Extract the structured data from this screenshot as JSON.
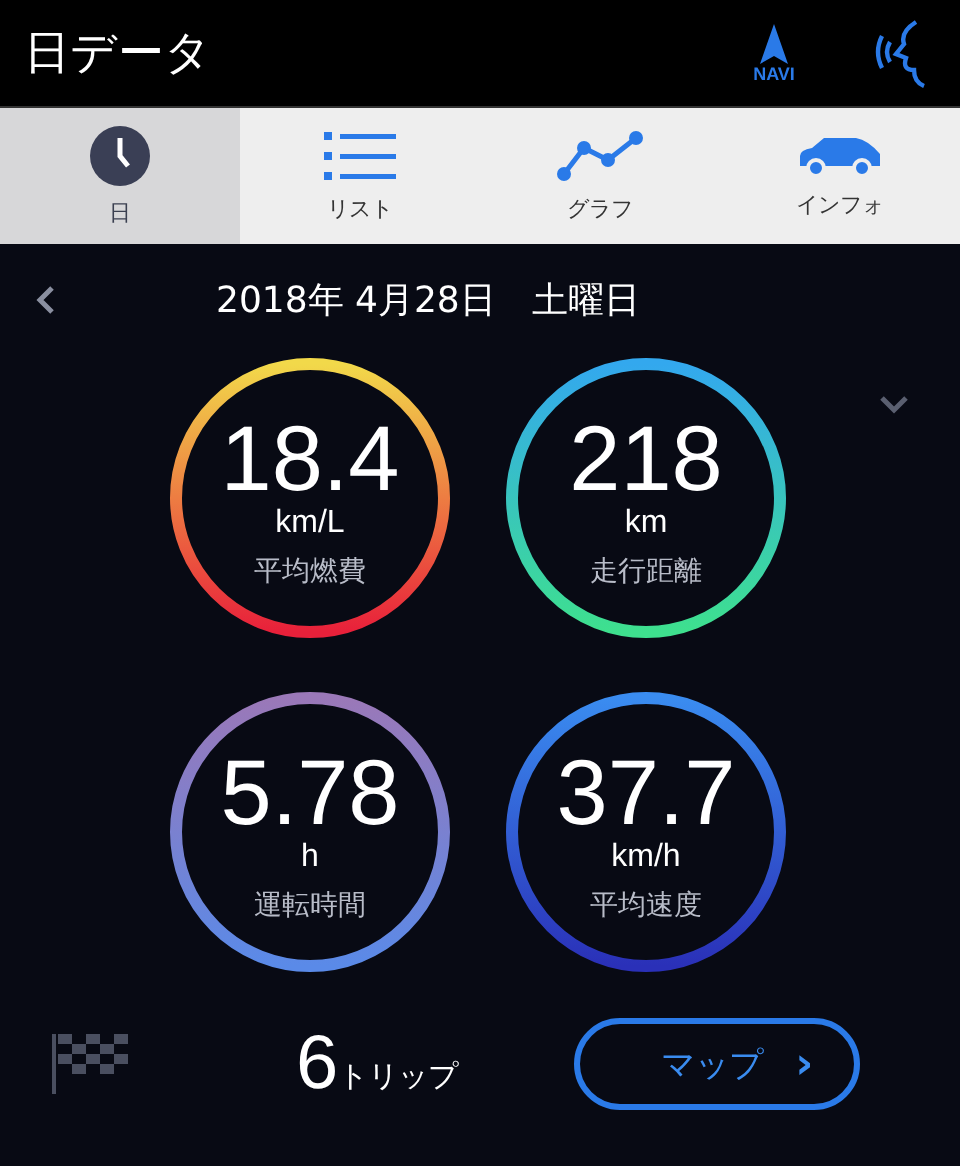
{
  "header": {
    "title": "日データ",
    "navi_label": "NAVI"
  },
  "tabs": [
    {
      "label": "日",
      "kind": "clock",
      "selected": true
    },
    {
      "label": "リスト",
      "kind": "list",
      "selected": false
    },
    {
      "label": "グラフ",
      "kind": "graph",
      "selected": false
    },
    {
      "label": "インフォ",
      "kind": "car",
      "selected": false
    }
  ],
  "date": "2018年 4月28日　土曜日",
  "metrics": [
    {
      "value": "18.4",
      "unit": "km/L",
      "label": "平均燃費",
      "color": "#f2d94a"
    },
    {
      "value": "218",
      "unit": "km",
      "label": "走行距離",
      "color": "#33a8ee"
    },
    {
      "value": "5.78",
      "unit": "h",
      "label": "運転時間",
      "color": "#9a78b8"
    },
    {
      "value": "37.7",
      "unit": "km/h",
      "label": "平均速度",
      "color": "#3a8cf0"
    }
  ],
  "trips": {
    "count": "6",
    "label": "トリップ"
  },
  "map_button": {
    "label": "マップ",
    "chevron": "›"
  }
}
